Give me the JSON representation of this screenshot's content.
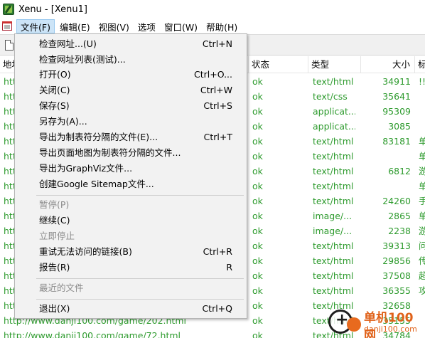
{
  "window": {
    "title": "Xenu - [Xenu1]"
  },
  "menubar": [
    {
      "label": "文件(F)",
      "active": true
    },
    {
      "label": "编辑(E)",
      "active": false
    },
    {
      "label": "视图(V)",
      "active": false
    },
    {
      "label": "选项",
      "active": false
    },
    {
      "label": "窗口(W)",
      "active": false
    },
    {
      "label": "帮助(H)",
      "active": false
    }
  ],
  "list": {
    "columns": {
      "address": "地址",
      "status": "状态",
      "type": "类型",
      "size": "大小",
      "title": "标"
    },
    "rows": [
      {
        "url": "htt",
        "status": "ok",
        "type": "text/html",
        "size": "34911",
        "title": "!!"
      },
      {
        "url": "htt",
        "status": "ok",
        "type": "text/css",
        "size": "35641",
        "title": ""
      },
      {
        "url": "htt",
        "status": "ok",
        "type": "applicat...",
        "size": "95309",
        "title": ""
      },
      {
        "url": "htt",
        "status": "ok",
        "type": "applicat...",
        "size": "3085",
        "title": ""
      },
      {
        "url": "htt",
        "status": "ok",
        "type": "text/html",
        "size": "83181",
        "title": "单"
      },
      {
        "url": "htt",
        "status": "ok",
        "type": "text/html",
        "size": "",
        "title": "单"
      },
      {
        "url": "htt",
        "status": "ok",
        "type": "text/html",
        "size": "6812",
        "title": "游"
      },
      {
        "url": "htt",
        "status": "ok",
        "type": "text/html",
        "size": "",
        "title": "单"
      },
      {
        "url": "htt",
        "status": "ok",
        "type": "text/html",
        "size": "24260",
        "title": "手"
      },
      {
        "url": "htt",
        "status": "ok",
        "type": "image/...",
        "size": "2865",
        "title": "单"
      },
      {
        "url": "htt",
        "status": "ok",
        "type": "image/...",
        "size": "2238",
        "title": "游"
      },
      {
        "url": "htt",
        "status": "ok",
        "type": "text/html",
        "size": "39313",
        "title": "问"
      },
      {
        "url": "htt",
        "status": "ok",
        "type": "text/html",
        "size": "29856",
        "title": "传"
      },
      {
        "url": "htt",
        "status": "ok",
        "type": "text/html",
        "size": "37508",
        "title": "超"
      },
      {
        "url": "htt",
        "status": "ok",
        "type": "text/html",
        "size": "36355",
        "title": "攻"
      },
      {
        "url": "htt",
        "status": "ok",
        "type": "text/html",
        "size": "32658",
        "title": ""
      },
      {
        "url": "http://www.danji100.com/game/202.html",
        "status": "ok",
        "type": "text/html",
        "size": "35155",
        "title": ""
      },
      {
        "url": "http://www.danji100.com/game/72.html",
        "status": "ok",
        "type": "text/html",
        "size": "34784",
        "title": ""
      }
    ]
  },
  "file_menu": [
    {
      "label": "检查网址...(U)",
      "shortcut": "Ctrl+N",
      "disabled": false
    },
    {
      "label": "检查网址列表(测试)...",
      "shortcut": "",
      "disabled": false
    },
    {
      "label": "打开(O)",
      "shortcut": "Ctrl+O...",
      "disabled": false
    },
    {
      "label": "关闭(C)",
      "shortcut": "Ctrl+W",
      "disabled": false
    },
    {
      "label": "保存(S)",
      "shortcut": "Ctrl+S",
      "disabled": false
    },
    {
      "label": "另存为(A)...",
      "shortcut": "",
      "disabled": false
    },
    {
      "label": "导出为制表符分隔的文件(E)...",
      "shortcut": "Ctrl+T",
      "disabled": false
    },
    {
      "label": "导出页面地图为制表符分隔的文件...",
      "shortcut": "",
      "disabled": false
    },
    {
      "label": "导出为GraphViz文件...",
      "shortcut": "",
      "disabled": false
    },
    {
      "label": "创建Google Sitemap文件...",
      "shortcut": "",
      "disabled": false
    },
    {
      "label": "暂停(P)",
      "shortcut": "",
      "disabled": true
    },
    {
      "label": "继续(C)",
      "shortcut": "",
      "disabled": false
    },
    {
      "label": "立即停止",
      "shortcut": "",
      "disabled": true
    },
    {
      "label": "重试无法访问的链接(B)",
      "shortcut": "Ctrl+R",
      "disabled": false
    },
    {
      "label": "报告(R)",
      "shortcut": "R",
      "disabled": false
    },
    {
      "label": "最近的文件",
      "shortcut": "",
      "disabled": true
    },
    {
      "label": "退出(X)",
      "shortcut": "Ctrl+Q",
      "disabled": false
    }
  ],
  "watermark": {
    "title": "单机100网",
    "url": "danji100.com"
  },
  "colors": {
    "link_green": "#2e9b2e",
    "menu_highlight": "#cce4f7",
    "watermark_orange": "#e0621a"
  }
}
